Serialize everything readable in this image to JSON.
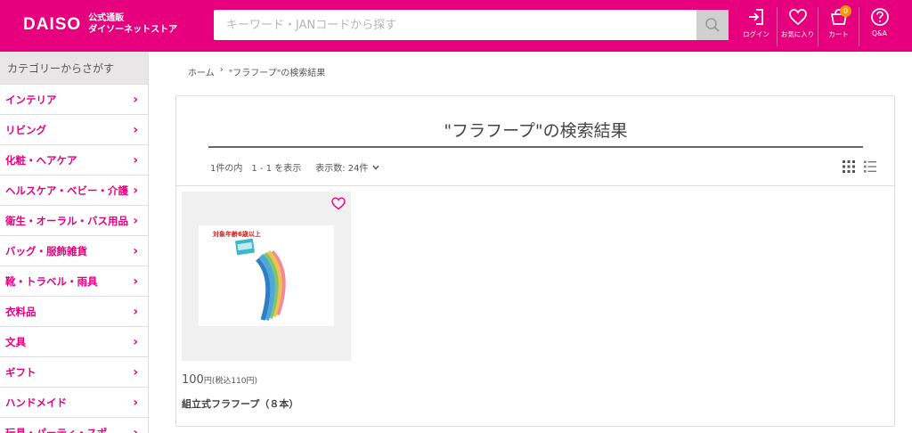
{
  "header": {
    "logo_text": "DAISO",
    "logo_line1": "公式通販",
    "logo_line2": "ダイソーネットストア",
    "search_placeholder": "キーワード・JANコードから探す",
    "login_label": "ログイン",
    "favorites_label": "お気に入り",
    "cart_label": "カート",
    "cart_count": "0",
    "qa_label": "Q&A",
    "brand_color": "#e6007e"
  },
  "sidebar": {
    "title": "カテゴリーからさがす",
    "items": [
      {
        "label": "インテリア"
      },
      {
        "label": "リビング"
      },
      {
        "label": "化粧・ヘアケア"
      },
      {
        "label": "ヘルスケア・ベビー・介護"
      },
      {
        "label": "衛生・オーラル・バス用品"
      },
      {
        "label": "バッグ・服飾雑貨"
      },
      {
        "label": "靴・トラベル・雨具"
      },
      {
        "label": "衣料品"
      },
      {
        "label": "文具"
      },
      {
        "label": "ギフト"
      },
      {
        "label": "ハンドメイド"
      },
      {
        "label": "玩具・パーティ・スポ"
      }
    ]
  },
  "breadcrumb": {
    "home": "ホーム",
    "separator": "›",
    "current": "\"フラフープ\"の検索結果"
  },
  "results": {
    "title": "\"フラフープ\"の検索結果",
    "summary": "1件の内　1 - 1 を表示",
    "per_page": "表示数: 24件"
  },
  "product": {
    "price": "100",
    "price_unit": "円",
    "tax_text": "(税込110円)",
    "name": "組立式フラフープ（８本）",
    "package_label": "対象年齢6歳以上"
  }
}
